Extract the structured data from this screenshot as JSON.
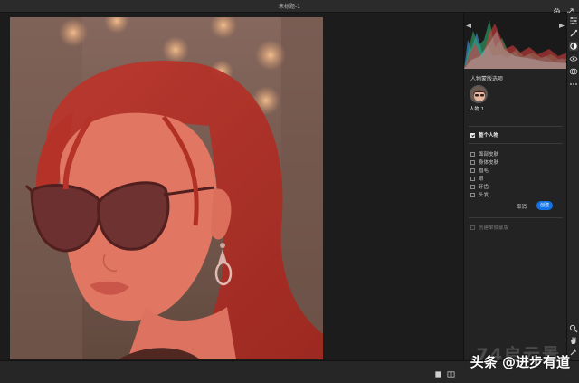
{
  "window": {
    "title": "未标题-1"
  },
  "toolbar_icons": [
    "gear-icon",
    "expand-icon",
    "edit-sliders-icon",
    "brush-icon",
    "masking-icon",
    "redeye-icon",
    "presets-icon",
    "more-icon",
    "zoom-icon",
    "hand-icon",
    "sampler-icon"
  ],
  "panel": {
    "section_title": "人物蒙版选项",
    "person_label": "人物 1",
    "entire_person_label": "整个人物",
    "entire_person_checked": true,
    "parts": [
      {
        "label": "面部皮肤",
        "checked": false
      },
      {
        "label": "身体皮肤",
        "checked": false
      },
      {
        "label": "眉毛",
        "checked": false
      },
      {
        "label": "眼",
        "checked": false
      },
      {
        "label": "牙齿",
        "checked": false
      },
      {
        "label": "头发",
        "checked": false
      }
    ],
    "cancel_label": "取消",
    "create_label": "创建",
    "separate_masks_label": "创建单独蒙版",
    "separate_masks_checked": false
  },
  "watermark": {
    "ghost_text": "74启云景",
    "main_text": "头条 @进步有道"
  },
  "colors": {
    "accent": "#1473e6",
    "mask_overlay": "#e0483c",
    "background": "#1e1e1e",
    "panel": "#232323"
  }
}
